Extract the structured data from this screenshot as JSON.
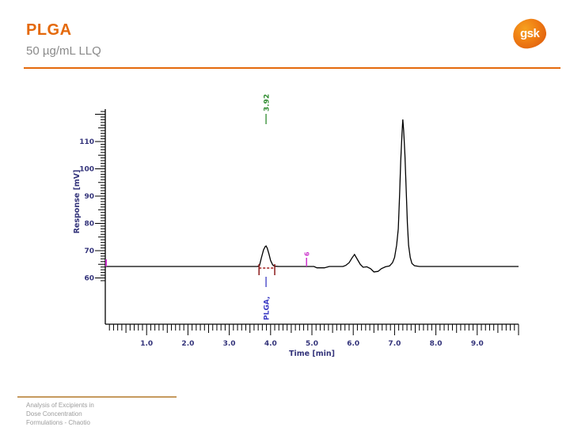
{
  "header": {
    "title": "PLGA",
    "subtitle": "50 µg/mL LLQ",
    "logo_text": "gsk"
  },
  "footer": {
    "lines": [
      "Analysis of Excipients in",
      "Dose Concentration",
      "Formulations - Chaotio"
    ]
  },
  "colors": {
    "accent_orange": "#E4690B",
    "footer_rule": "#C69A5E",
    "axis_line": "#000000",
    "axis_label": "#33337A",
    "trace": "#000000",
    "retention_label": "#2E8B2E",
    "compound_label": "#3B3BC4",
    "event_marker": "#CC33CC",
    "integration": "#A02020",
    "integration_tick": "#8B1A1A"
  },
  "chart_data": {
    "type": "line",
    "title": "",
    "xlabel": "Time [min]",
    "ylabel": "Response [mV]",
    "xlim": [
      0,
      10
    ],
    "ylim": [
      58,
      122
    ],
    "grid": false,
    "x_major_ticks": [
      1,
      2,
      3,
      4,
      5,
      6,
      7,
      8,
      9
    ],
    "x_tick_labels": [
      "1.0",
      "2.0",
      "3.0",
      "4.0",
      "5.0",
      "6.0",
      "7.0",
      "8.0",
      "9.0"
    ],
    "y_major_ticks": [
      60,
      70,
      80,
      90,
      100,
      110
    ],
    "y_tick_labels": [
      "60",
      "70",
      "80",
      "90",
      "100",
      "110"
    ],
    "baseline_mv": 64.2,
    "trace": [
      [
        0.0,
        64.2
      ],
      [
        3.68,
        64.2
      ],
      [
        3.73,
        64.5
      ],
      [
        3.78,
        67.5
      ],
      [
        3.83,
        70.3
      ],
      [
        3.87,
        71.5
      ],
      [
        3.89,
        71.7
      ],
      [
        3.92,
        70.9
      ],
      [
        3.96,
        68.8
      ],
      [
        4.0,
        66.4
      ],
      [
        4.05,
        64.8
      ],
      [
        4.1,
        64.3
      ],
      [
        4.2,
        64.2
      ],
      [
        5.05,
        64.2
      ],
      [
        5.12,
        63.7
      ],
      [
        5.3,
        63.7
      ],
      [
        5.42,
        64.2
      ],
      [
        5.75,
        64.2
      ],
      [
        5.82,
        64.6
      ],
      [
        5.9,
        65.6
      ],
      [
        5.97,
        67.3
      ],
      [
        6.03,
        68.6
      ],
      [
        6.1,
        66.8
      ],
      [
        6.17,
        65.0
      ],
      [
        6.24,
        63.9
      ],
      [
        6.33,
        64.1
      ],
      [
        6.42,
        63.4
      ],
      [
        6.5,
        62.2
      ],
      [
        6.6,
        62.4
      ],
      [
        6.68,
        63.4
      ],
      [
        6.78,
        64.1
      ],
      [
        6.88,
        64.4
      ],
      [
        6.95,
        65.6
      ],
      [
        7.0,
        67.5
      ],
      [
        7.05,
        72.0
      ],
      [
        7.09,
        78.0
      ],
      [
        7.12,
        90.0
      ],
      [
        7.15,
        103.0
      ],
      [
        7.18,
        113.0
      ],
      [
        7.2,
        118.1
      ],
      [
        7.22,
        114.0
      ],
      [
        7.25,
        105.0
      ],
      [
        7.28,
        93.0
      ],
      [
        7.31,
        80.0
      ],
      [
        7.34,
        72.0
      ],
      [
        7.38,
        67.5
      ],
      [
        7.42,
        65.3
      ],
      [
        7.48,
        64.5
      ],
      [
        7.6,
        64.2
      ],
      [
        10.0,
        64.2
      ]
    ],
    "annotations": {
      "retention_time": {
        "text": "3.92",
        "t": 3.89
      },
      "compound": {
        "text": "PLGA,",
        "t": 3.89
      },
      "event_marker": {
        "text": "6",
        "t": 4.87
      },
      "integration_start_t": 3.72,
      "integration_end_t": 4.1,
      "trace_start_marker_t": 0.02
    }
  }
}
